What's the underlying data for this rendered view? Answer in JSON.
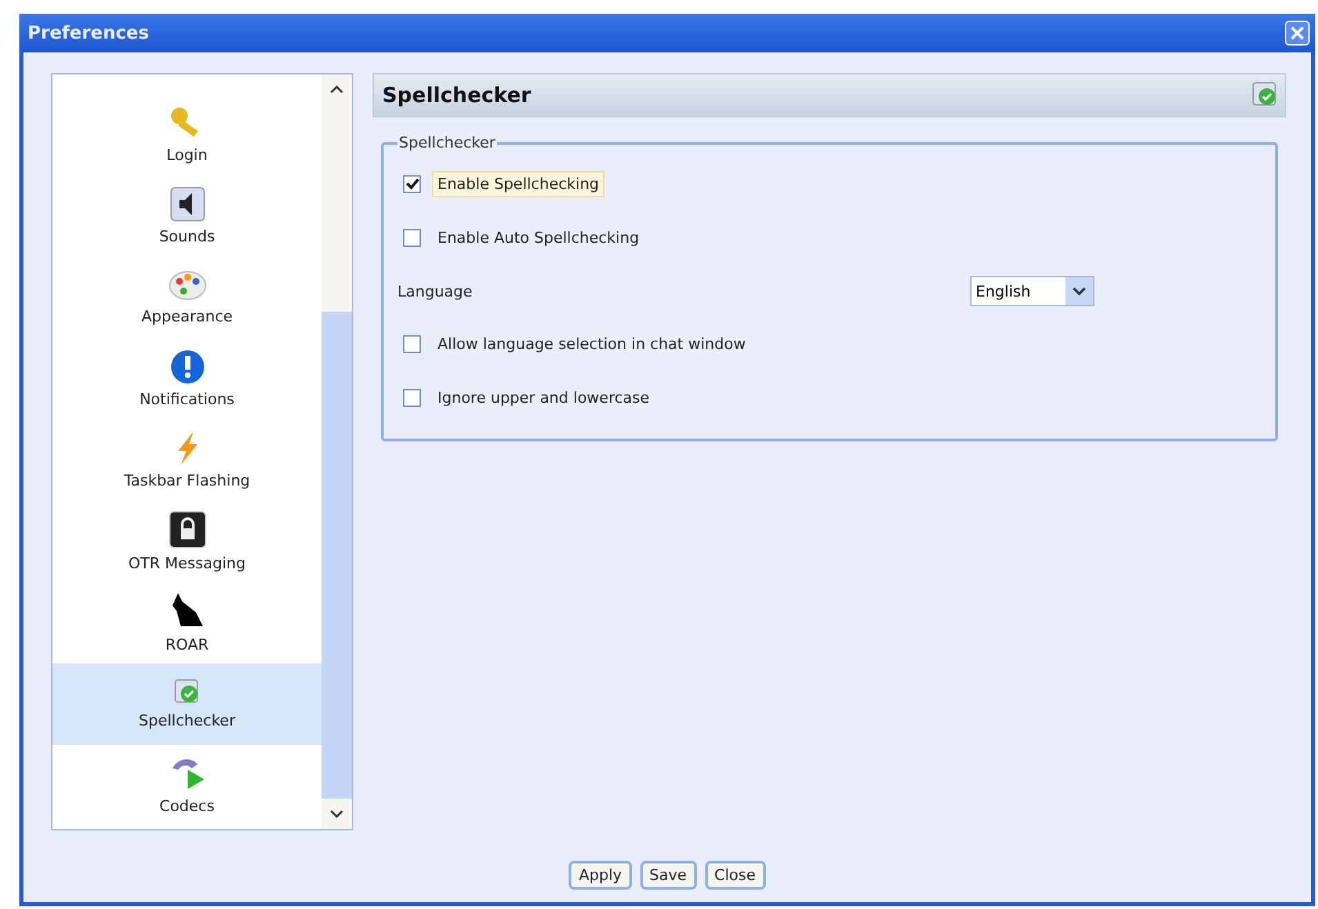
{
  "window": {
    "title": "Preferences"
  },
  "sidebar": {
    "items": [
      {
        "label": "Login",
        "selected": false
      },
      {
        "label": "Sounds",
        "selected": false
      },
      {
        "label": "Appearance",
        "selected": false
      },
      {
        "label": "Notifications",
        "selected": false
      },
      {
        "label": "Taskbar Flashing",
        "selected": false
      },
      {
        "label": "OTR Messaging",
        "selected": false
      },
      {
        "label": "ROAR",
        "selected": false
      },
      {
        "label": "Spellchecker",
        "selected": true
      },
      {
        "label": "Codecs",
        "selected": false
      }
    ]
  },
  "panel": {
    "title": "Spellchecker",
    "group_title": "Spellchecker",
    "options": [
      {
        "kind": "checkbox",
        "label": "Enable Spellchecking",
        "checked": true,
        "focused": true
      },
      {
        "kind": "checkbox",
        "label": "Enable Auto Spellchecking",
        "checked": false,
        "focused": false
      },
      {
        "kind": "select",
        "label": "Language",
        "value": "English"
      },
      {
        "kind": "checkbox",
        "label": "Allow language selection in chat window",
        "checked": false,
        "focused": false
      },
      {
        "kind": "checkbox",
        "label": "Ignore upper and lowercase",
        "checked": false,
        "focused": false
      }
    ]
  },
  "buttons": [
    "Apply",
    "Save",
    "Close"
  ]
}
